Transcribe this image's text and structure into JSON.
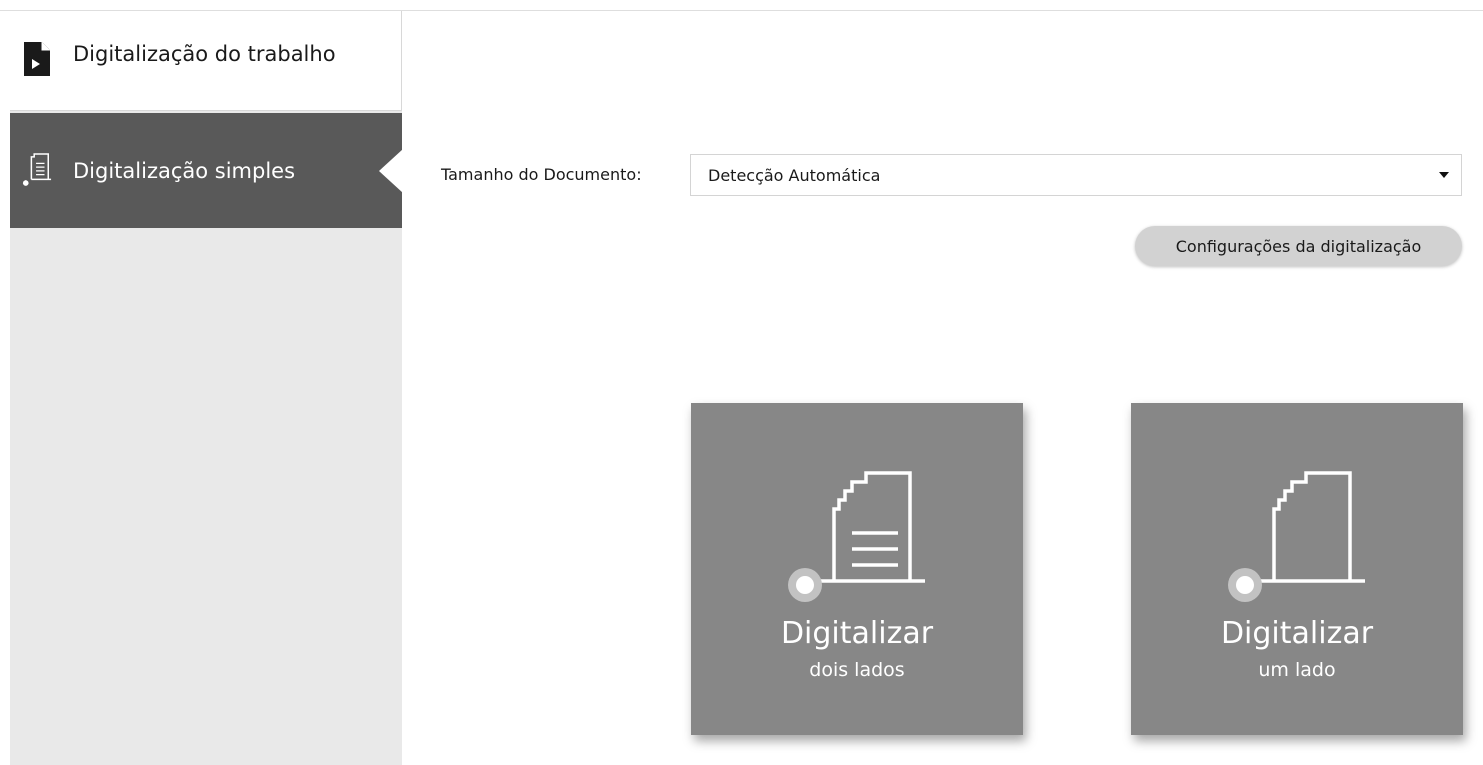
{
  "sidebar": {
    "items": [
      {
        "label": "Digitalização do trabalho",
        "icon": "job-scan-icon",
        "selected": false
      },
      {
        "label": "Digitalização simples",
        "icon": "simple-scan-icon",
        "selected": true
      }
    ]
  },
  "document_size": {
    "label": "Tamanho do Documento:",
    "value": "Detecção Automática"
  },
  "settings_button": {
    "label": "Configurações da digitalização"
  },
  "tiles": [
    {
      "title": "Digitalizar",
      "subtitle": "dois lados",
      "icon": "scan-two-sides-icon"
    },
    {
      "title": "Digitalizar",
      "subtitle": "um lado",
      "icon": "scan-one-side-icon"
    }
  ],
  "colors": {
    "sidebar_bg": "#e9e9e9",
    "sidebar_selected_bg": "#595959",
    "tile_bg": "#878787",
    "button_bg": "#d2d2d2"
  }
}
